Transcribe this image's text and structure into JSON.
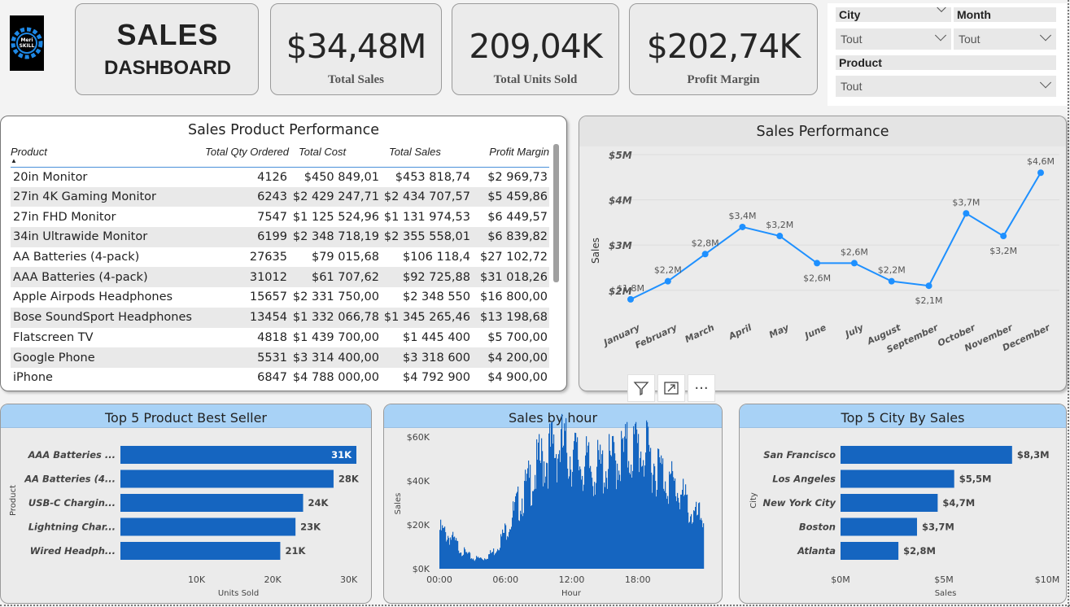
{
  "header": {
    "logo_text_1": "Meri",
    "logo_text_2": "SKILL",
    "title": "SALES",
    "subtitle": "DASHBOARD"
  },
  "kpis": [
    {
      "value": "$34,48M",
      "label": "Total Sales"
    },
    {
      "value": "209,04K",
      "label": "Total Units Sold"
    },
    {
      "value": "$202,74K",
      "label": "Profit Margin"
    }
  ],
  "filters": {
    "city": {
      "label": "City",
      "value": "Tout"
    },
    "month": {
      "label": "Month",
      "value": "Tout"
    },
    "product": {
      "label": "Product",
      "value": "Tout"
    }
  },
  "performance_table": {
    "title": "Sales Product Performance",
    "columns": [
      "Product",
      "Total Qty Ordered",
      "Total Cost",
      "Total Sales",
      "Profit Margin"
    ],
    "rows": [
      [
        "20in Monitor",
        "4126",
        "$450 849,01",
        "$453 818,74",
        "$2 969,73"
      ],
      [
        "27in 4K Gaming Monitor",
        "6243",
        "$2 429 247,71",
        "$2 434 707,57",
        "$5 459,86"
      ],
      [
        "27in FHD Monitor",
        "7547",
        "$1 125 524,96",
        "$1 131 974,53",
        "$6 449,57"
      ],
      [
        "34in Ultrawide Monitor",
        "6199",
        "$2 348 718,19",
        "$2 355 558,01",
        "$6 839,82"
      ],
      [
        "AA Batteries (4-pack)",
        "27635",
        "$79 015,68",
        "$106 118,4",
        "$27 102,72"
      ],
      [
        "AAA Batteries (4-pack)",
        "31012",
        "$61 707,62",
        "$92 725,88",
        "$31 018,26"
      ],
      [
        "Apple Airpods Headphones",
        "15657",
        "$2 331 750,00",
        "$2 348 550",
        "$16 800,00"
      ],
      [
        "Bose SoundSport Headphones",
        "13454",
        "$1 332 066,78",
        "$1 345 265,46",
        "$13 198,68"
      ],
      [
        "Flatscreen TV",
        "4818",
        "$1 439 700,00",
        "$1 445 400",
        "$5 700,00"
      ],
      [
        "Google Phone",
        "5531",
        "$3 314 400,00",
        "$3 318 600",
        "$4 200,00"
      ],
      [
        "iPhone",
        "6847",
        "$4 788 000,00",
        "$4 792 900",
        "$4 900,00"
      ]
    ]
  },
  "toolbar": {
    "filter_icon": "filter-icon",
    "focus_icon": "expand-icon",
    "more_label": "···"
  },
  "chart_data": [
    {
      "type": "line",
      "title": "Sales Performance",
      "ylabel": "Sales",
      "categories": [
        "January",
        "February",
        "March",
        "April",
        "May",
        "June",
        "July",
        "August",
        "September",
        "October",
        "November",
        "December"
      ],
      "values": [
        1.8,
        2.2,
        2.8,
        3.4,
        3.2,
        2.6,
        2.6,
        2.2,
        2.1,
        3.7,
        3.2,
        4.6
      ],
      "data_labels": [
        "$1,8M",
        "$2,2M",
        "$2,8M",
        "$3,4M",
        "$3,2M",
        "$2,6M",
        "$2,6M",
        "$2,2M",
        "$2,1M",
        "$3,7M",
        "$3,2M",
        "$4,6M"
      ],
      "yticks": [
        "$2M",
        "$3M",
        "$4M",
        "$5M"
      ],
      "ylim": [
        1.6,
        5
      ],
      "color": "#1e90ff"
    },
    {
      "type": "bar",
      "orientation": "horizontal",
      "title": "Top 5 Product Best Seller",
      "categories": [
        "AAA Batteries ...",
        "AA Batteries (4...",
        "USB-C Chargin...",
        "Lightning Char...",
        "Wired Headph..."
      ],
      "values": [
        31,
        28,
        24,
        23,
        21
      ],
      "data_labels": [
        "31K",
        "28K",
        "24K",
        "23K",
        "21K"
      ],
      "xlabel": "Units Sold",
      "ylabel": "Product",
      "xticks": [
        "10K",
        "20K",
        "30K"
      ],
      "xlim": [
        0,
        31
      ],
      "color": "#1565c0"
    },
    {
      "type": "area",
      "title": "Sales by hour",
      "xlabel": "Hour",
      "ylabel": "Sales",
      "xticks": [
        "00:00",
        "06:00",
        "12:00",
        "18:00"
      ],
      "yticks": [
        "$0K",
        "$20K",
        "$40K",
        "$60K"
      ],
      "ylim": [
        0,
        60
      ],
      "x": [
        0,
        1,
        2,
        3,
        4,
        5,
        6,
        7,
        8,
        9,
        10,
        11,
        12,
        13,
        14,
        15,
        16,
        17,
        18,
        19,
        20,
        21,
        22,
        23
      ],
      "values": [
        15,
        12,
        7,
        4,
        4,
        7,
        15,
        24,
        32,
        40,
        45,
        47,
        44,
        40,
        38,
        39,
        42,
        45,
        47,
        43,
        38,
        33,
        28,
        20
      ],
      "color": "#1565c0"
    },
    {
      "type": "bar",
      "orientation": "horizontal",
      "title": "Top 5 City By Sales",
      "categories": [
        "San Francisco",
        "Los Angeles",
        "New York City",
        "Boston",
        "Atlanta"
      ],
      "values": [
        8.3,
        5.5,
        4.7,
        3.7,
        2.8
      ],
      "data_labels": [
        "$8,3M",
        "$5,5M",
        "$4,7M",
        "$3,7M",
        "$2,8M"
      ],
      "xlabel": "Sales",
      "ylabel": "City",
      "xticks": [
        "$0M",
        "$5M",
        "$10M"
      ],
      "xlim": [
        0,
        10
      ],
      "color": "#1565c0"
    }
  ]
}
